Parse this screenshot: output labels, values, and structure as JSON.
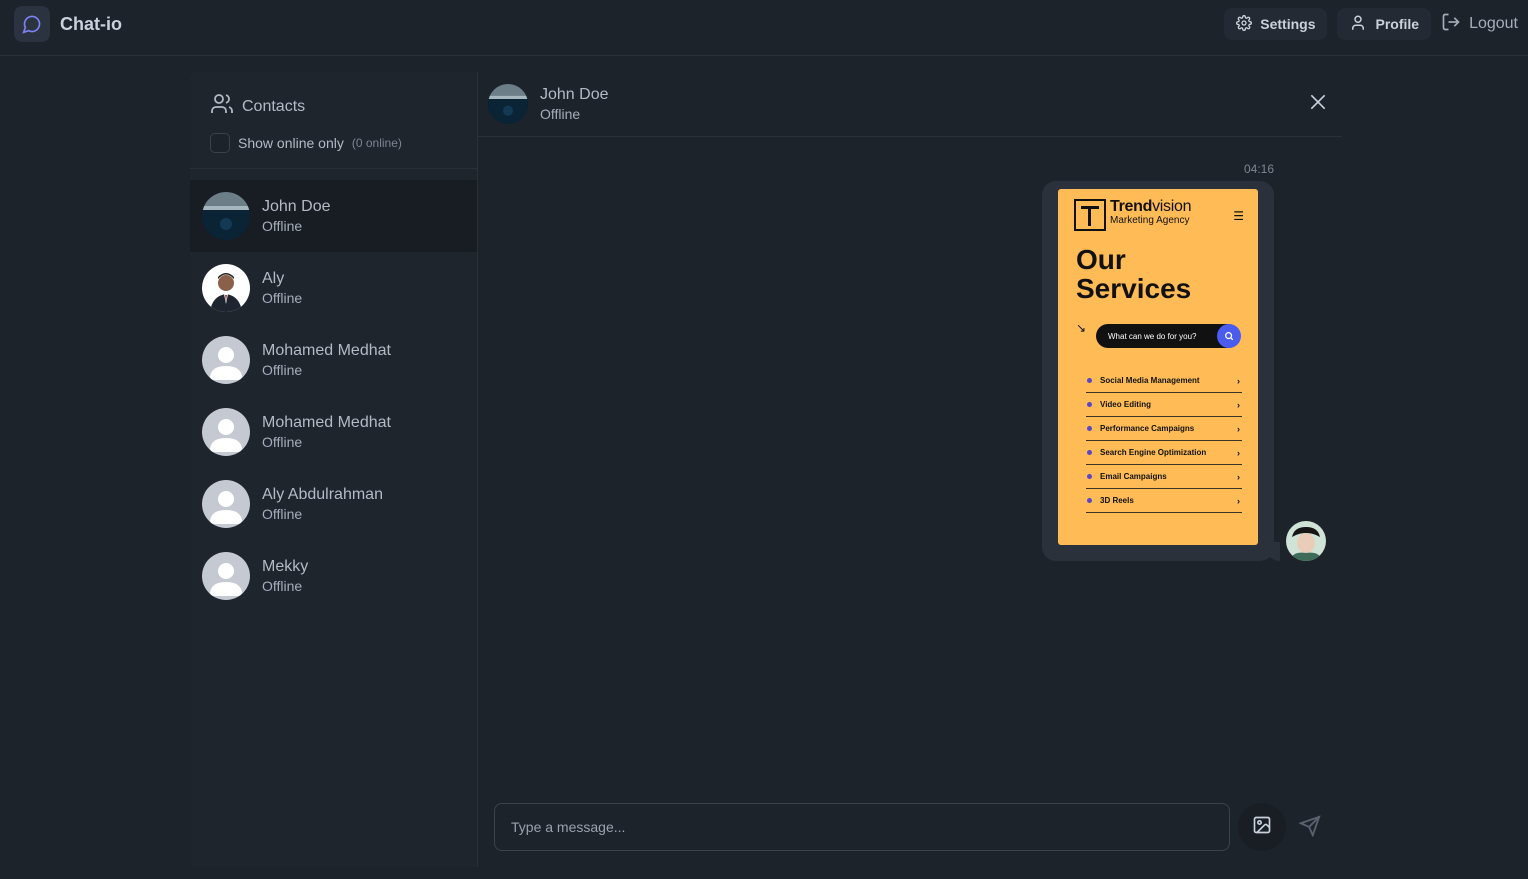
{
  "app": {
    "name": "Chat-io"
  },
  "nav": {
    "settings": "Settings",
    "profile": "Profile",
    "logout": "Logout"
  },
  "sidebar": {
    "title": "Contacts",
    "online_filter_label": "Show online only",
    "online_count": "(0 online)",
    "contacts": [
      {
        "name": "John Doe",
        "status": "Offline",
        "avatar": "photo-dark-scene"
      },
      {
        "name": "Aly",
        "status": "Offline",
        "avatar": "photo-person-suit"
      },
      {
        "name": "Mohamed Medhat",
        "status": "Offline",
        "avatar": "default-user"
      },
      {
        "name": "Mohamed Medhat",
        "status": "Offline",
        "avatar": "default-user"
      },
      {
        "name": "Aly Abdulrahman",
        "status": "Offline",
        "avatar": "default-user"
      },
      {
        "name": "Mekky",
        "status": "Offline",
        "avatar": "default-user"
      }
    ]
  },
  "chat": {
    "contact_name": "John Doe",
    "contact_status": "Offline",
    "message_time": "04:16",
    "image_content": {
      "brand_bold": "Trend",
      "brand_rest": "vision",
      "brand_sub": "Marketing Agency",
      "heading_line1": "Our",
      "heading_line2": "Services",
      "search_text": "What can we do for you?",
      "services": [
        "Social Media Management",
        "Video Editing",
        "Performance Campaigns",
        "Search Engine Optimization",
        "Email Campaigns",
        "3D Reels"
      ]
    },
    "composer_placeholder": "Type a message..."
  },
  "colors": {
    "accent": "#4a5cf0",
    "image_bg": "#ffbb55",
    "bubble": "#2b313b"
  }
}
